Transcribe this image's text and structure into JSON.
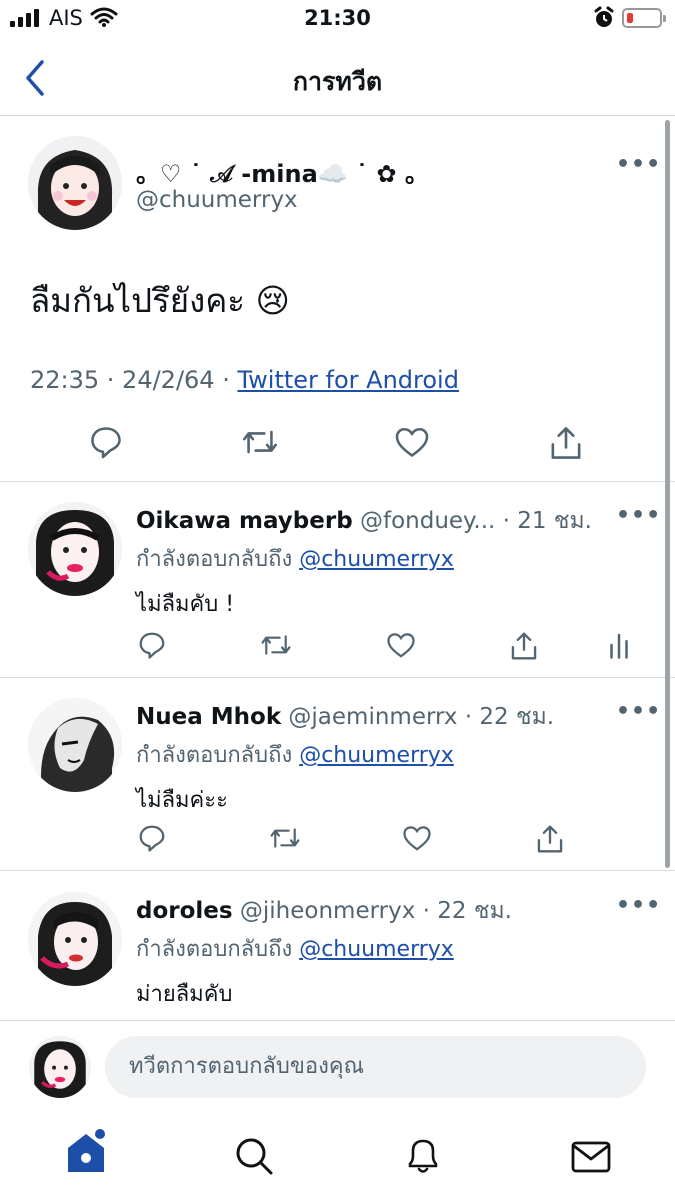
{
  "status_bar": {
    "carrier": "AIS",
    "time": "21:30"
  },
  "nav": {
    "title": "การทวีต"
  },
  "main_tweet": {
    "display_name": "。♡ ˙ 𝒜 -mina☁️ ˙ ✿ 。",
    "handle": "@chuumerryx",
    "text": "ลืมกันไปรึยังคะ 😢",
    "meta_time": "22:35 · 24/2/64 · ",
    "meta_source": "Twitter for Android"
  },
  "replies": [
    {
      "display_name": "Oikawa mayberb",
      "handle_time": " @fonduey... · 21 ชม.",
      "replying_label": "กำลังตอบกลับถึง ",
      "replying_handle": "@chuumerryx",
      "text": "ไม่ลืมคับ !"
    },
    {
      "display_name": "Nuea Mhok",
      "handle_time": " @jaeminmerrx · 22 ชม.",
      "replying_label": "กำลังตอบกลับถึง ",
      "replying_handle": "@chuumerryx",
      "text": "ไม่ลืมค่ะะ"
    },
    {
      "display_name": "doroles",
      "handle_time": " @jiheonmerryx · 22 ชม.",
      "replying_label": "กำลังตอบกลับถึง ",
      "replying_handle": "@chuumerryx",
      "text": "ม่ายลืมคับ"
    }
  ],
  "compose": {
    "placeholder": "ทวีตการตอบกลับของคุณ"
  },
  "icons": {
    "back": "chevron-left-icon",
    "more": "more-horizontal-icon",
    "reply": "reply-icon",
    "retweet": "retweet-icon",
    "like": "heart-icon",
    "share": "share-icon",
    "analytics": "analytics-icon",
    "home": "home-icon",
    "search": "search-icon",
    "notifications": "bell-icon",
    "messages": "mail-icon"
  },
  "colors": {
    "accent": "#1d4ea8",
    "muted": "#536471",
    "battery_low": "#e53935"
  }
}
